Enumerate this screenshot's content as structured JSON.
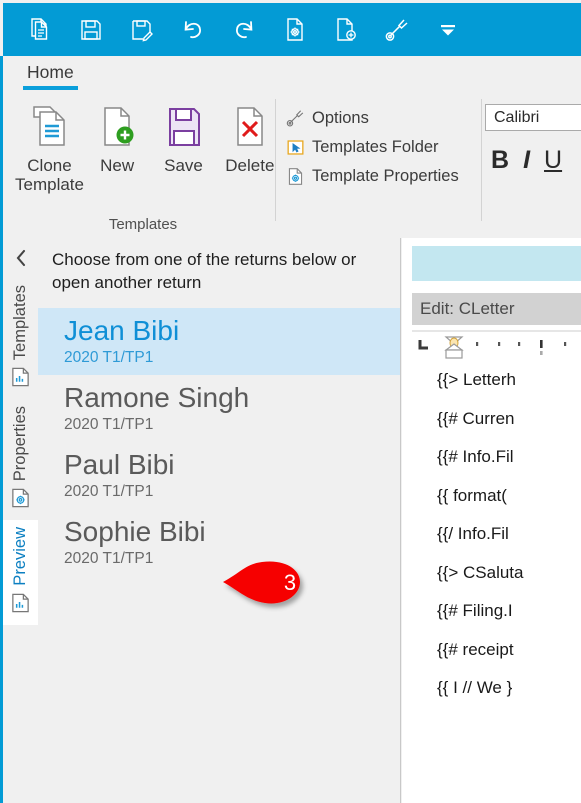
{
  "quick_access_toolbar": {
    "buttons": [
      {
        "name": "new-document-icon",
        "tooltip": "New Document"
      },
      {
        "name": "save-icon",
        "tooltip": "Save"
      },
      {
        "name": "save-as-icon",
        "tooltip": "Save As"
      },
      {
        "name": "undo-icon",
        "tooltip": "Undo"
      },
      {
        "name": "redo-icon",
        "tooltip": "Redo"
      },
      {
        "name": "document-settings-icon",
        "tooltip": "Document Settings"
      },
      {
        "name": "add-document-icon",
        "tooltip": "Add Document"
      },
      {
        "name": "wrench-icon",
        "tooltip": "Tools"
      },
      {
        "name": "customize-dropdown-icon",
        "tooltip": "Customize Quick Access Toolbar"
      }
    ]
  },
  "ribbon": {
    "tabs": [
      {
        "label": "Home",
        "active": true
      }
    ],
    "groups": {
      "templates": {
        "label": "Templates",
        "big_buttons": [
          {
            "label": "Clone\nTemplate",
            "label_line1": "Clone",
            "label_line2": "Template",
            "icon": "clone-template-icon"
          },
          {
            "label": "New",
            "icon": "new-template-icon"
          },
          {
            "label": "Save",
            "icon": "save-template-icon"
          },
          {
            "label": "Delete",
            "icon": "delete-template-icon"
          }
        ],
        "small_buttons": [
          {
            "label": "Options",
            "icon": "wrench-icon"
          },
          {
            "label": "Templates Folder",
            "icon": "folder-cursor-icon"
          },
          {
            "label": "Template Properties",
            "icon": "template-properties-icon"
          }
        ]
      },
      "font": {
        "font_name": "Calibri",
        "bold_label": "B",
        "italic_label": "I",
        "underline_label": "U"
      }
    }
  },
  "side_tabs": [
    {
      "label": "Templates",
      "icon": "templates-tab-icon",
      "active": false
    },
    {
      "label": "Properties",
      "icon": "properties-tab-icon",
      "active": false
    },
    {
      "label": "Preview",
      "icon": "preview-tab-icon",
      "active": true
    }
  ],
  "collapse_button": {
    "icon": "chevron-left-icon"
  },
  "return_panel": {
    "heading": "Choose from one of the returns below or open another return",
    "returns": [
      {
        "name": "Jean Bibi",
        "year": "2020 T1/TP1",
        "selected": true
      },
      {
        "name": "Ramone Singh",
        "year": "2020 T1/TP1",
        "selected": false
      },
      {
        "name": "Paul Bibi",
        "year": "2020 T1/TP1",
        "selected": false
      },
      {
        "name": "Sophie Bibi",
        "year": "2020 T1/TP1",
        "selected": false
      }
    ]
  },
  "callout": {
    "number": "3",
    "color": "#f60000"
  },
  "editor": {
    "title": "Edit: CLetter",
    "lines": [
      "{{> Letterh",
      "{{# Curren",
      "{{# Info.Fil",
      "{{ format(",
      "{{/ Info.Fil",
      "{{> CSaluta",
      "{{# Filing.I",
      "{{# receipt",
      "{{ I // We }"
    ]
  },
  "colors": {
    "accent_blue": "#039bd5",
    "tab_underline": "#0b9fdb",
    "selection_bg": "#cfe7f7",
    "selection_text": "#0f8fd6",
    "panel_bg": "#f0f0f0",
    "callout_red": "#f60000",
    "band_blue": "#c3e7f0",
    "title_gray": "#d2d2d2"
  }
}
